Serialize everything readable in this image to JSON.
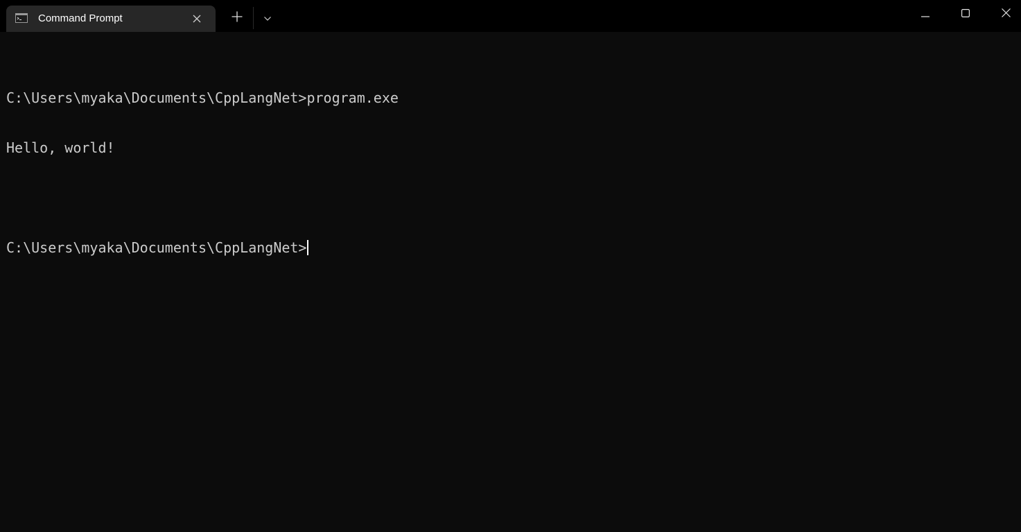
{
  "tab": {
    "title": "Command Prompt",
    "icon": "cmd-icon"
  },
  "titlebar": {
    "new_tab_icon": "plus-icon",
    "dropdown_icon": "chevron-down-icon",
    "minimize_icon": "minimize-icon",
    "maximize_icon": "maximize-icon",
    "close_icon": "close-icon"
  },
  "terminal": {
    "lines": [
      "C:\\Users\\myaka\\Documents\\CppLangNet>program.exe",
      "Hello, world!",
      "",
      "C:\\Users\\myaka\\Documents\\CppLangNet>"
    ],
    "text_color": "#cccccc",
    "background": "#0c0c0c"
  }
}
